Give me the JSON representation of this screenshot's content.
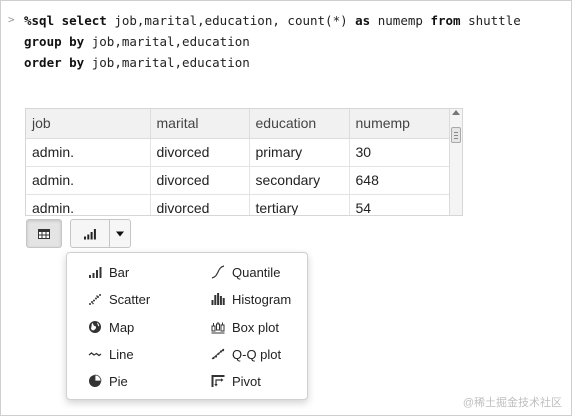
{
  "cell": {
    "prompt": ">",
    "line1_kw1": "%sql select",
    "line1_rest": " job,marital,education, count(*) ",
    "line1_kw2": "as",
    "line1_mid": " numemp ",
    "line1_kw3": "from",
    "line1_end": " shuttle",
    "line2_kw": "group by",
    "line2_rest": " job,marital,education",
    "line3_kw": "order by",
    "line3_rest": " job,marital,education"
  },
  "table": {
    "headers": [
      "job",
      "marital",
      "education",
      "numemp"
    ],
    "rows": [
      [
        "admin.",
        "divorced",
        "primary",
        "30"
      ],
      [
        "admin.",
        "divorced",
        "secondary",
        "648"
      ],
      [
        "admin.",
        "divorced",
        "tertiary",
        "54"
      ]
    ]
  },
  "toolbar": {
    "table_icon": "table-icon",
    "chart_icon": "bar-chart-icon",
    "caret_icon": "caret-down-icon"
  },
  "chart_menu": {
    "left": [
      {
        "label": "Bar",
        "icon": "bar-chart-icon"
      },
      {
        "label": "Scatter",
        "icon": "scatter-icon"
      },
      {
        "label": "Map",
        "icon": "globe-icon"
      },
      {
        "label": "Line",
        "icon": "line-chart-icon"
      },
      {
        "label": "Pie",
        "icon": "pie-chart-icon"
      }
    ],
    "right": [
      {
        "label": "Quantile",
        "icon": "quantile-icon"
      },
      {
        "label": "Histogram",
        "icon": "histogram-icon"
      },
      {
        "label": "Box plot",
        "icon": "box-plot-icon"
      },
      {
        "label": "Q-Q plot",
        "icon": "qq-plot-icon"
      },
      {
        "label": "Pivot",
        "icon": "pivot-icon"
      }
    ]
  },
  "watermark": "@稀土掘金技术社区"
}
